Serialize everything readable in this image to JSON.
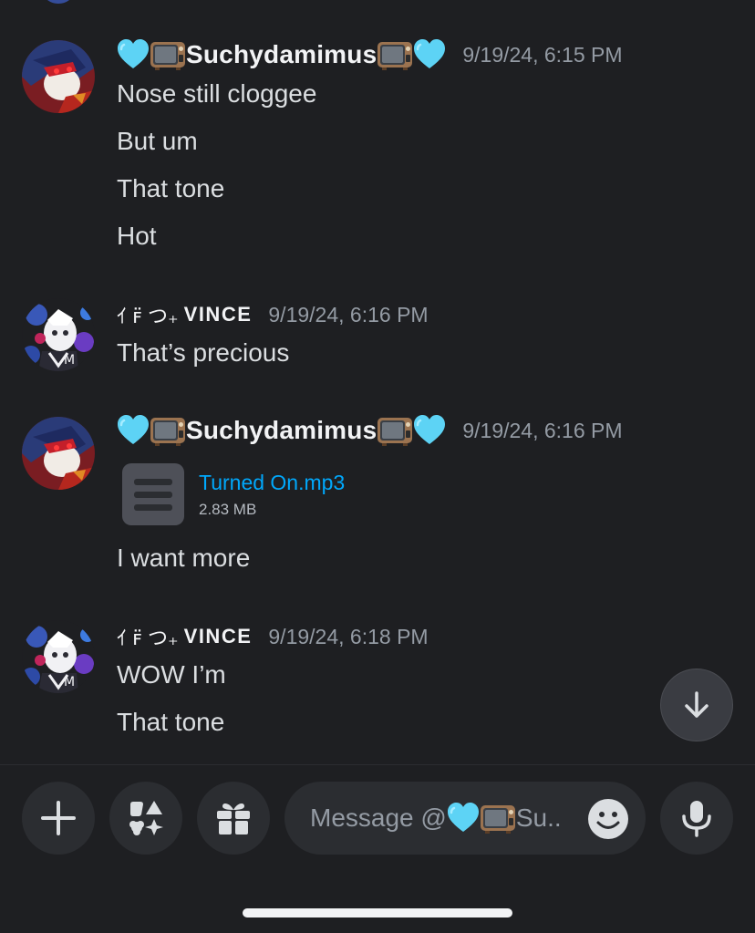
{
  "messages": [
    {
      "author": "Suchydamimus",
      "timestamp": "9/19/24, 6:15 PM",
      "lines": [
        "Nose still cloggee",
        "But um",
        "That tone",
        "Hot"
      ]
    },
    {
      "author": "VINCE",
      "author_prefix": "ｲ ꜰ̈ つ₊",
      "timestamp": "9/19/24, 6:16 PM",
      "lines": [
        "That’s precious"
      ]
    },
    {
      "author": "Suchydamimus",
      "timestamp": "9/19/24, 6:16 PM",
      "attachment": {
        "name": "Turned On.mp3",
        "size": "2.83 MB"
      },
      "lines": [
        "I want more"
      ]
    },
    {
      "author": "VINCE",
      "author_prefix": "ｲ ꜰ̈ つ₊",
      "timestamp": "9/19/24, 6:18 PM",
      "lines": [
        "WOW I’m",
        "That tone"
      ]
    }
  ],
  "composer": {
    "placeholder_prefix": "Message @",
    "placeholder_suffix": "Su.."
  },
  "icons": {
    "add": "plus-icon",
    "apps": "apps-icon",
    "gift": "gift-icon",
    "emoji": "emoji-icon",
    "mic": "mic-icon",
    "scroll": "arrow-down-icon"
  },
  "colors": {
    "background": "#1e1f22",
    "link": "#00a8fc",
    "timestamp": "#949ba4"
  }
}
